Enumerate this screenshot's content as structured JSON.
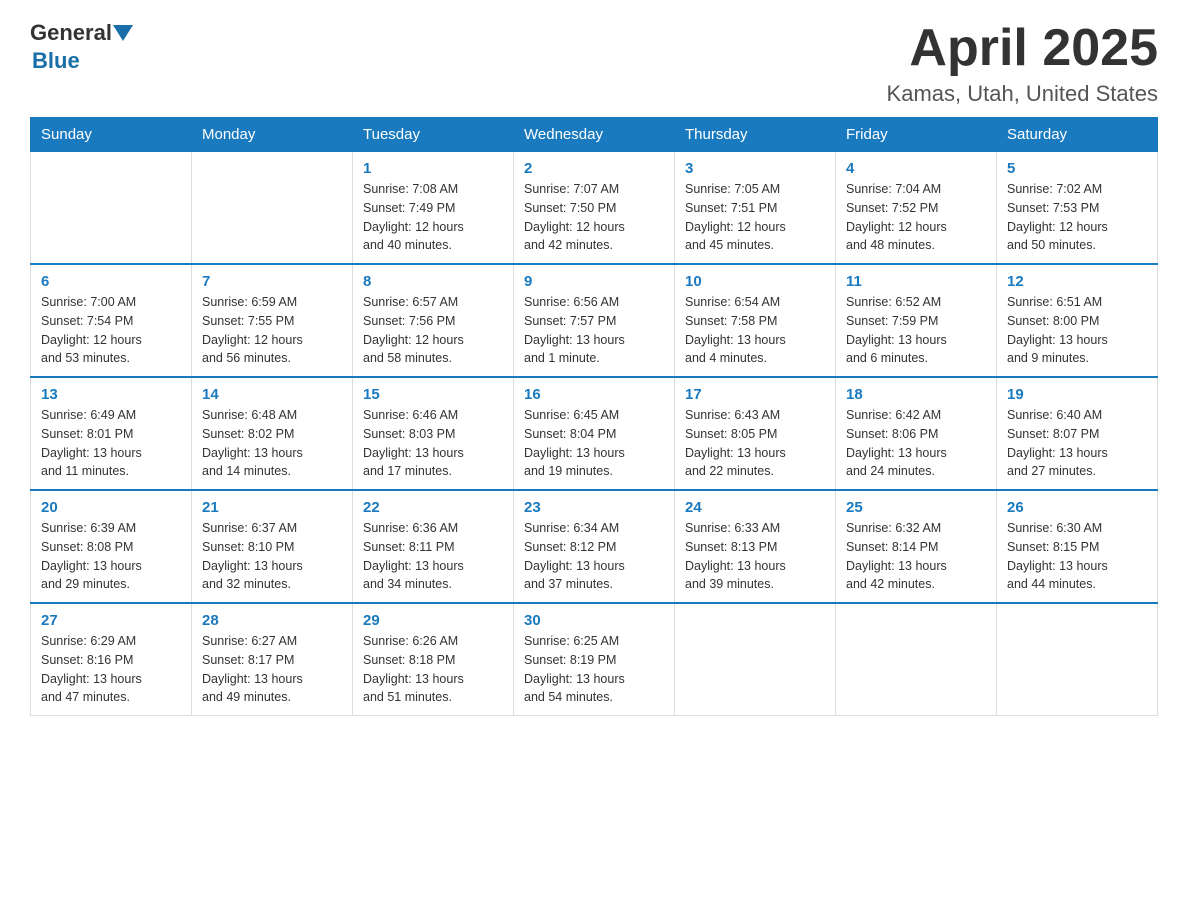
{
  "header": {
    "logo_general": "General",
    "logo_blue": "Blue",
    "month_title": "April 2025",
    "location": "Kamas, Utah, United States"
  },
  "days_of_week": [
    "Sunday",
    "Monday",
    "Tuesday",
    "Wednesday",
    "Thursday",
    "Friday",
    "Saturday"
  ],
  "weeks": [
    [
      {
        "day": "",
        "info": ""
      },
      {
        "day": "",
        "info": ""
      },
      {
        "day": "1",
        "info": "Sunrise: 7:08 AM\nSunset: 7:49 PM\nDaylight: 12 hours\nand 40 minutes."
      },
      {
        "day": "2",
        "info": "Sunrise: 7:07 AM\nSunset: 7:50 PM\nDaylight: 12 hours\nand 42 minutes."
      },
      {
        "day": "3",
        "info": "Sunrise: 7:05 AM\nSunset: 7:51 PM\nDaylight: 12 hours\nand 45 minutes."
      },
      {
        "day": "4",
        "info": "Sunrise: 7:04 AM\nSunset: 7:52 PM\nDaylight: 12 hours\nand 48 minutes."
      },
      {
        "day": "5",
        "info": "Sunrise: 7:02 AM\nSunset: 7:53 PM\nDaylight: 12 hours\nand 50 minutes."
      }
    ],
    [
      {
        "day": "6",
        "info": "Sunrise: 7:00 AM\nSunset: 7:54 PM\nDaylight: 12 hours\nand 53 minutes."
      },
      {
        "day": "7",
        "info": "Sunrise: 6:59 AM\nSunset: 7:55 PM\nDaylight: 12 hours\nand 56 minutes."
      },
      {
        "day": "8",
        "info": "Sunrise: 6:57 AM\nSunset: 7:56 PM\nDaylight: 12 hours\nand 58 minutes."
      },
      {
        "day": "9",
        "info": "Sunrise: 6:56 AM\nSunset: 7:57 PM\nDaylight: 13 hours\nand 1 minute."
      },
      {
        "day": "10",
        "info": "Sunrise: 6:54 AM\nSunset: 7:58 PM\nDaylight: 13 hours\nand 4 minutes."
      },
      {
        "day": "11",
        "info": "Sunrise: 6:52 AM\nSunset: 7:59 PM\nDaylight: 13 hours\nand 6 minutes."
      },
      {
        "day": "12",
        "info": "Sunrise: 6:51 AM\nSunset: 8:00 PM\nDaylight: 13 hours\nand 9 minutes."
      }
    ],
    [
      {
        "day": "13",
        "info": "Sunrise: 6:49 AM\nSunset: 8:01 PM\nDaylight: 13 hours\nand 11 minutes."
      },
      {
        "day": "14",
        "info": "Sunrise: 6:48 AM\nSunset: 8:02 PM\nDaylight: 13 hours\nand 14 minutes."
      },
      {
        "day": "15",
        "info": "Sunrise: 6:46 AM\nSunset: 8:03 PM\nDaylight: 13 hours\nand 17 minutes."
      },
      {
        "day": "16",
        "info": "Sunrise: 6:45 AM\nSunset: 8:04 PM\nDaylight: 13 hours\nand 19 minutes."
      },
      {
        "day": "17",
        "info": "Sunrise: 6:43 AM\nSunset: 8:05 PM\nDaylight: 13 hours\nand 22 minutes."
      },
      {
        "day": "18",
        "info": "Sunrise: 6:42 AM\nSunset: 8:06 PM\nDaylight: 13 hours\nand 24 minutes."
      },
      {
        "day": "19",
        "info": "Sunrise: 6:40 AM\nSunset: 8:07 PM\nDaylight: 13 hours\nand 27 minutes."
      }
    ],
    [
      {
        "day": "20",
        "info": "Sunrise: 6:39 AM\nSunset: 8:08 PM\nDaylight: 13 hours\nand 29 minutes."
      },
      {
        "day": "21",
        "info": "Sunrise: 6:37 AM\nSunset: 8:10 PM\nDaylight: 13 hours\nand 32 minutes."
      },
      {
        "day": "22",
        "info": "Sunrise: 6:36 AM\nSunset: 8:11 PM\nDaylight: 13 hours\nand 34 minutes."
      },
      {
        "day": "23",
        "info": "Sunrise: 6:34 AM\nSunset: 8:12 PM\nDaylight: 13 hours\nand 37 minutes."
      },
      {
        "day": "24",
        "info": "Sunrise: 6:33 AM\nSunset: 8:13 PM\nDaylight: 13 hours\nand 39 minutes."
      },
      {
        "day": "25",
        "info": "Sunrise: 6:32 AM\nSunset: 8:14 PM\nDaylight: 13 hours\nand 42 minutes."
      },
      {
        "day": "26",
        "info": "Sunrise: 6:30 AM\nSunset: 8:15 PM\nDaylight: 13 hours\nand 44 minutes."
      }
    ],
    [
      {
        "day": "27",
        "info": "Sunrise: 6:29 AM\nSunset: 8:16 PM\nDaylight: 13 hours\nand 47 minutes."
      },
      {
        "day": "28",
        "info": "Sunrise: 6:27 AM\nSunset: 8:17 PM\nDaylight: 13 hours\nand 49 minutes."
      },
      {
        "day": "29",
        "info": "Sunrise: 6:26 AM\nSunset: 8:18 PM\nDaylight: 13 hours\nand 51 minutes."
      },
      {
        "day": "30",
        "info": "Sunrise: 6:25 AM\nSunset: 8:19 PM\nDaylight: 13 hours\nand 54 minutes."
      },
      {
        "day": "",
        "info": ""
      },
      {
        "day": "",
        "info": ""
      },
      {
        "day": "",
        "info": ""
      }
    ]
  ]
}
